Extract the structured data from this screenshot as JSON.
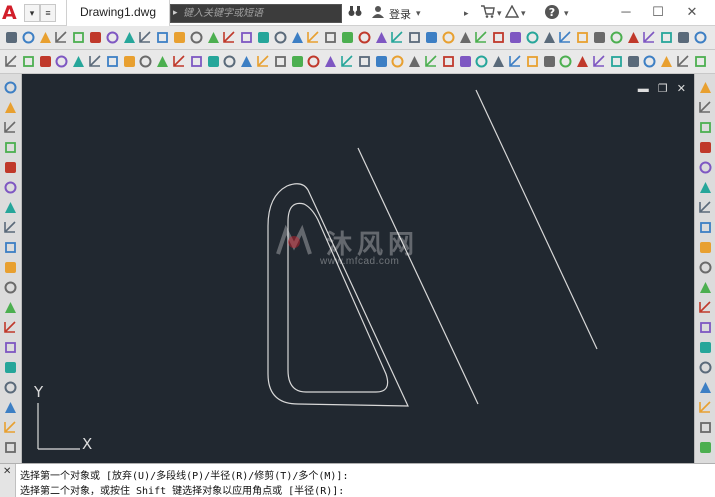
{
  "title_bar": {
    "logo": "A",
    "file_tab": "Drawing1.dwg",
    "search_placeholder": "键入关键字或短语",
    "login_label": "登录",
    "help_label": "?"
  },
  "colors": {
    "accent": "#d21e2a",
    "canvas_bg": "#212830",
    "geometry": "#d8d8d8",
    "toolbar_bg": "#e9e9e9"
  },
  "canvas": {
    "viewport_controls": [
      "▬",
      "❐",
      "✕"
    ],
    "ucs_y": "Y",
    "ucs_x": "X",
    "watermark_text": "沐风网",
    "watermark_url": "www.mfcad.com"
  },
  "command_line": {
    "lines": [
      "选择第一个对象或 [放弃(U)/多段线(P)/半径(R)/修剪(T)/多个(M)]:",
      "选择第二个对象，或按住 Shift 键选择对象以应用角点或 [半径(R)]:"
    ]
  }
}
